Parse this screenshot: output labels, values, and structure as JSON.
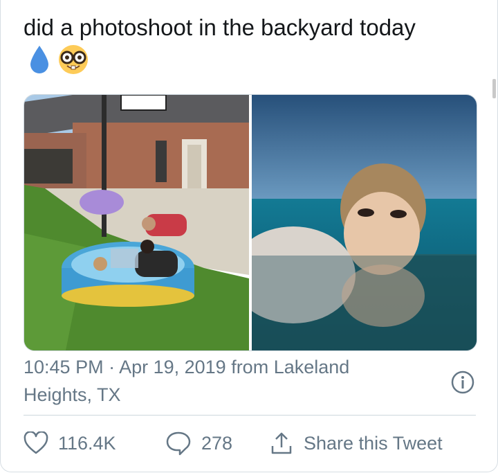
{
  "tweet": {
    "text": "did a photoshoot in the backyard today",
    "emojis": [
      "droplet-emoji",
      "nerd-face-emoji"
    ]
  },
  "media": {
    "photos": [
      {
        "icon": "backyard-pool-photo"
      },
      {
        "icon": "underwater-portrait-photo"
      }
    ]
  },
  "meta": {
    "timestamp": "10:45 PM · Apr 19, 2019 from Lakeland Heights, TX"
  },
  "actions": {
    "like_count": "116.4K",
    "reply_count": "278",
    "share_label": "Share this Tweet"
  },
  "colors": {
    "text": "#14171a",
    "secondary": "#657786",
    "border": "#ccd6dd"
  }
}
